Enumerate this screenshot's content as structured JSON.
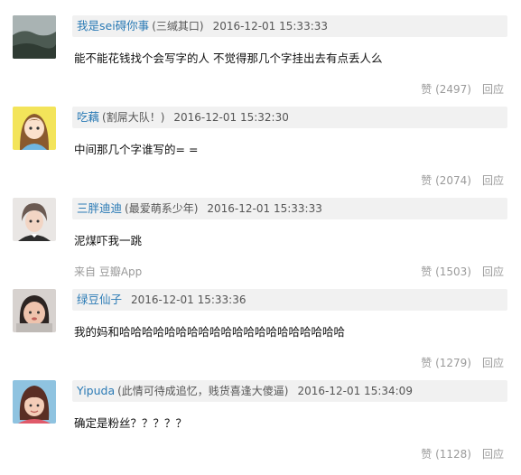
{
  "comments": [
    {
      "username": "我是sei碍你事",
      "signature": "(三缄其口)",
      "time": "2016-12-01 15:33:33",
      "content": "能不能花钱找个会写字的人 不觉得那几个字挂出去有点丢人么",
      "likes": "(2497)",
      "source": ""
    },
    {
      "username": "吃藕",
      "signature": "(割屌大队！)",
      "time": "2016-12-01 15:32:30",
      "content": "中间那几个字谁写的= =",
      "likes": "(2074)",
      "source": ""
    },
    {
      "username": "三胖迪迪",
      "signature": "(最爱萌系少年)",
      "time": "2016-12-01 15:33:33",
      "content": "泥煤吓我一跳",
      "likes": "(1503)",
      "source": "来自 豆瓣App"
    },
    {
      "username": "绿豆仙子",
      "signature": "",
      "time": "2016-12-01 15:33:36",
      "content": "我的妈和哈哈哈哈哈哈哈哈哈哈哈哈哈哈哈哈哈哈哈哈",
      "likes": "(1279)",
      "source": ""
    },
    {
      "username": "Yipuda",
      "signature": "(此情可待成追忆，贱货喜逢大傻逼)",
      "time": "2016-12-01 15:34:09",
      "content": "确定是粉丝？？？？？",
      "likes": "(1128)",
      "source": ""
    }
  ],
  "labels": {
    "like": "赞",
    "reply": "回应"
  },
  "colors": {
    "username": "#2a7ab5",
    "meta_bg": "#f1f1f1",
    "muted": "#9a9a9a"
  },
  "icons": [
    "avatar-landscape-icon",
    "avatar-cartoon-girl-icon",
    "avatar-boy-icon",
    "avatar-girl-icon",
    "avatar-girl-bangs-icon"
  ]
}
